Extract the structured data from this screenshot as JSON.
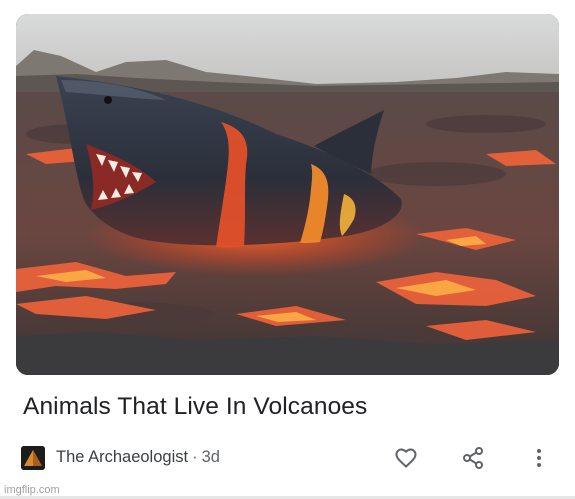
{
  "card": {
    "image_alt": "Shark emerging from volcanic lava field",
    "headline": "Animals That Live In Volcanoes",
    "source_name": "The Archaeologist",
    "separator": "·",
    "age": "3d"
  },
  "actions": {
    "like_icon": "heart-outline-icon",
    "share_icon": "share-icon",
    "more_icon": "vertical-ellipsis-icon"
  },
  "watermark": "imgflip.com",
  "colors": {
    "text_primary": "#202124",
    "text_secondary": "#5f6368",
    "icon": "#5f6368",
    "lava": "#e8502a"
  }
}
